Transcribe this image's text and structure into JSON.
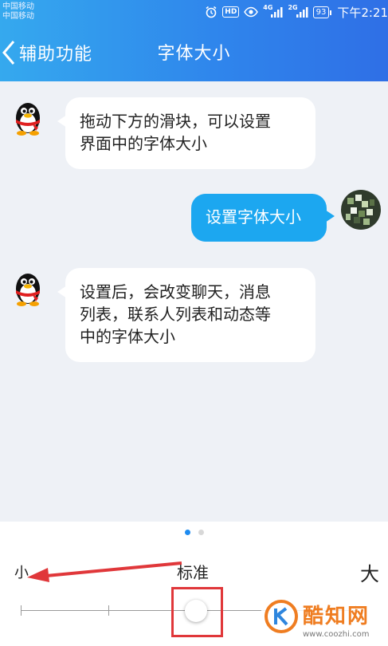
{
  "status_bar": {
    "carrier_line1": "中国移动",
    "carrier_line2": "中国移动",
    "icons": [
      "alarm-icon",
      "hd-icon",
      "eye-icon",
      "signal-4g-icon",
      "signal-2g-icon",
      "battery-icon"
    ],
    "hd_label": "HD",
    "net1_label": "4G",
    "net2_label": "2G",
    "battery_level": "93",
    "time": "下午2:21"
  },
  "header": {
    "back_label": "辅助功能",
    "title": "字体大小",
    "background_colors": [
      "#35a9ee",
      "#2f6fe6"
    ]
  },
  "chat": {
    "messages": [
      {
        "side": "left",
        "avatar": "qq-penguin-avatar",
        "lines": [
          "拖动下方的滑块，可以设置",
          "界面中的字体大小"
        ]
      },
      {
        "side": "right",
        "avatar": "user-avatar",
        "lines": [
          "设置字体大小"
        ]
      },
      {
        "side": "left",
        "avatar": "qq-penguin-avatar",
        "lines": [
          "设置后，会改变聊天，消息",
          "列表，联系人列表和动态等",
          "中的字体大小"
        ]
      }
    ],
    "out_bubble_color": "#1ca7f0"
  },
  "pager": {
    "pages": 2,
    "active": 1
  },
  "font_slider": {
    "label_small": "小",
    "label_standard": "标准",
    "label_large": "大",
    "steps": 5,
    "selected_step": 3,
    "selected_fraction": 0.5
  },
  "watermark": {
    "name": "酷知网",
    "url": "www.coozhi.com"
  }
}
